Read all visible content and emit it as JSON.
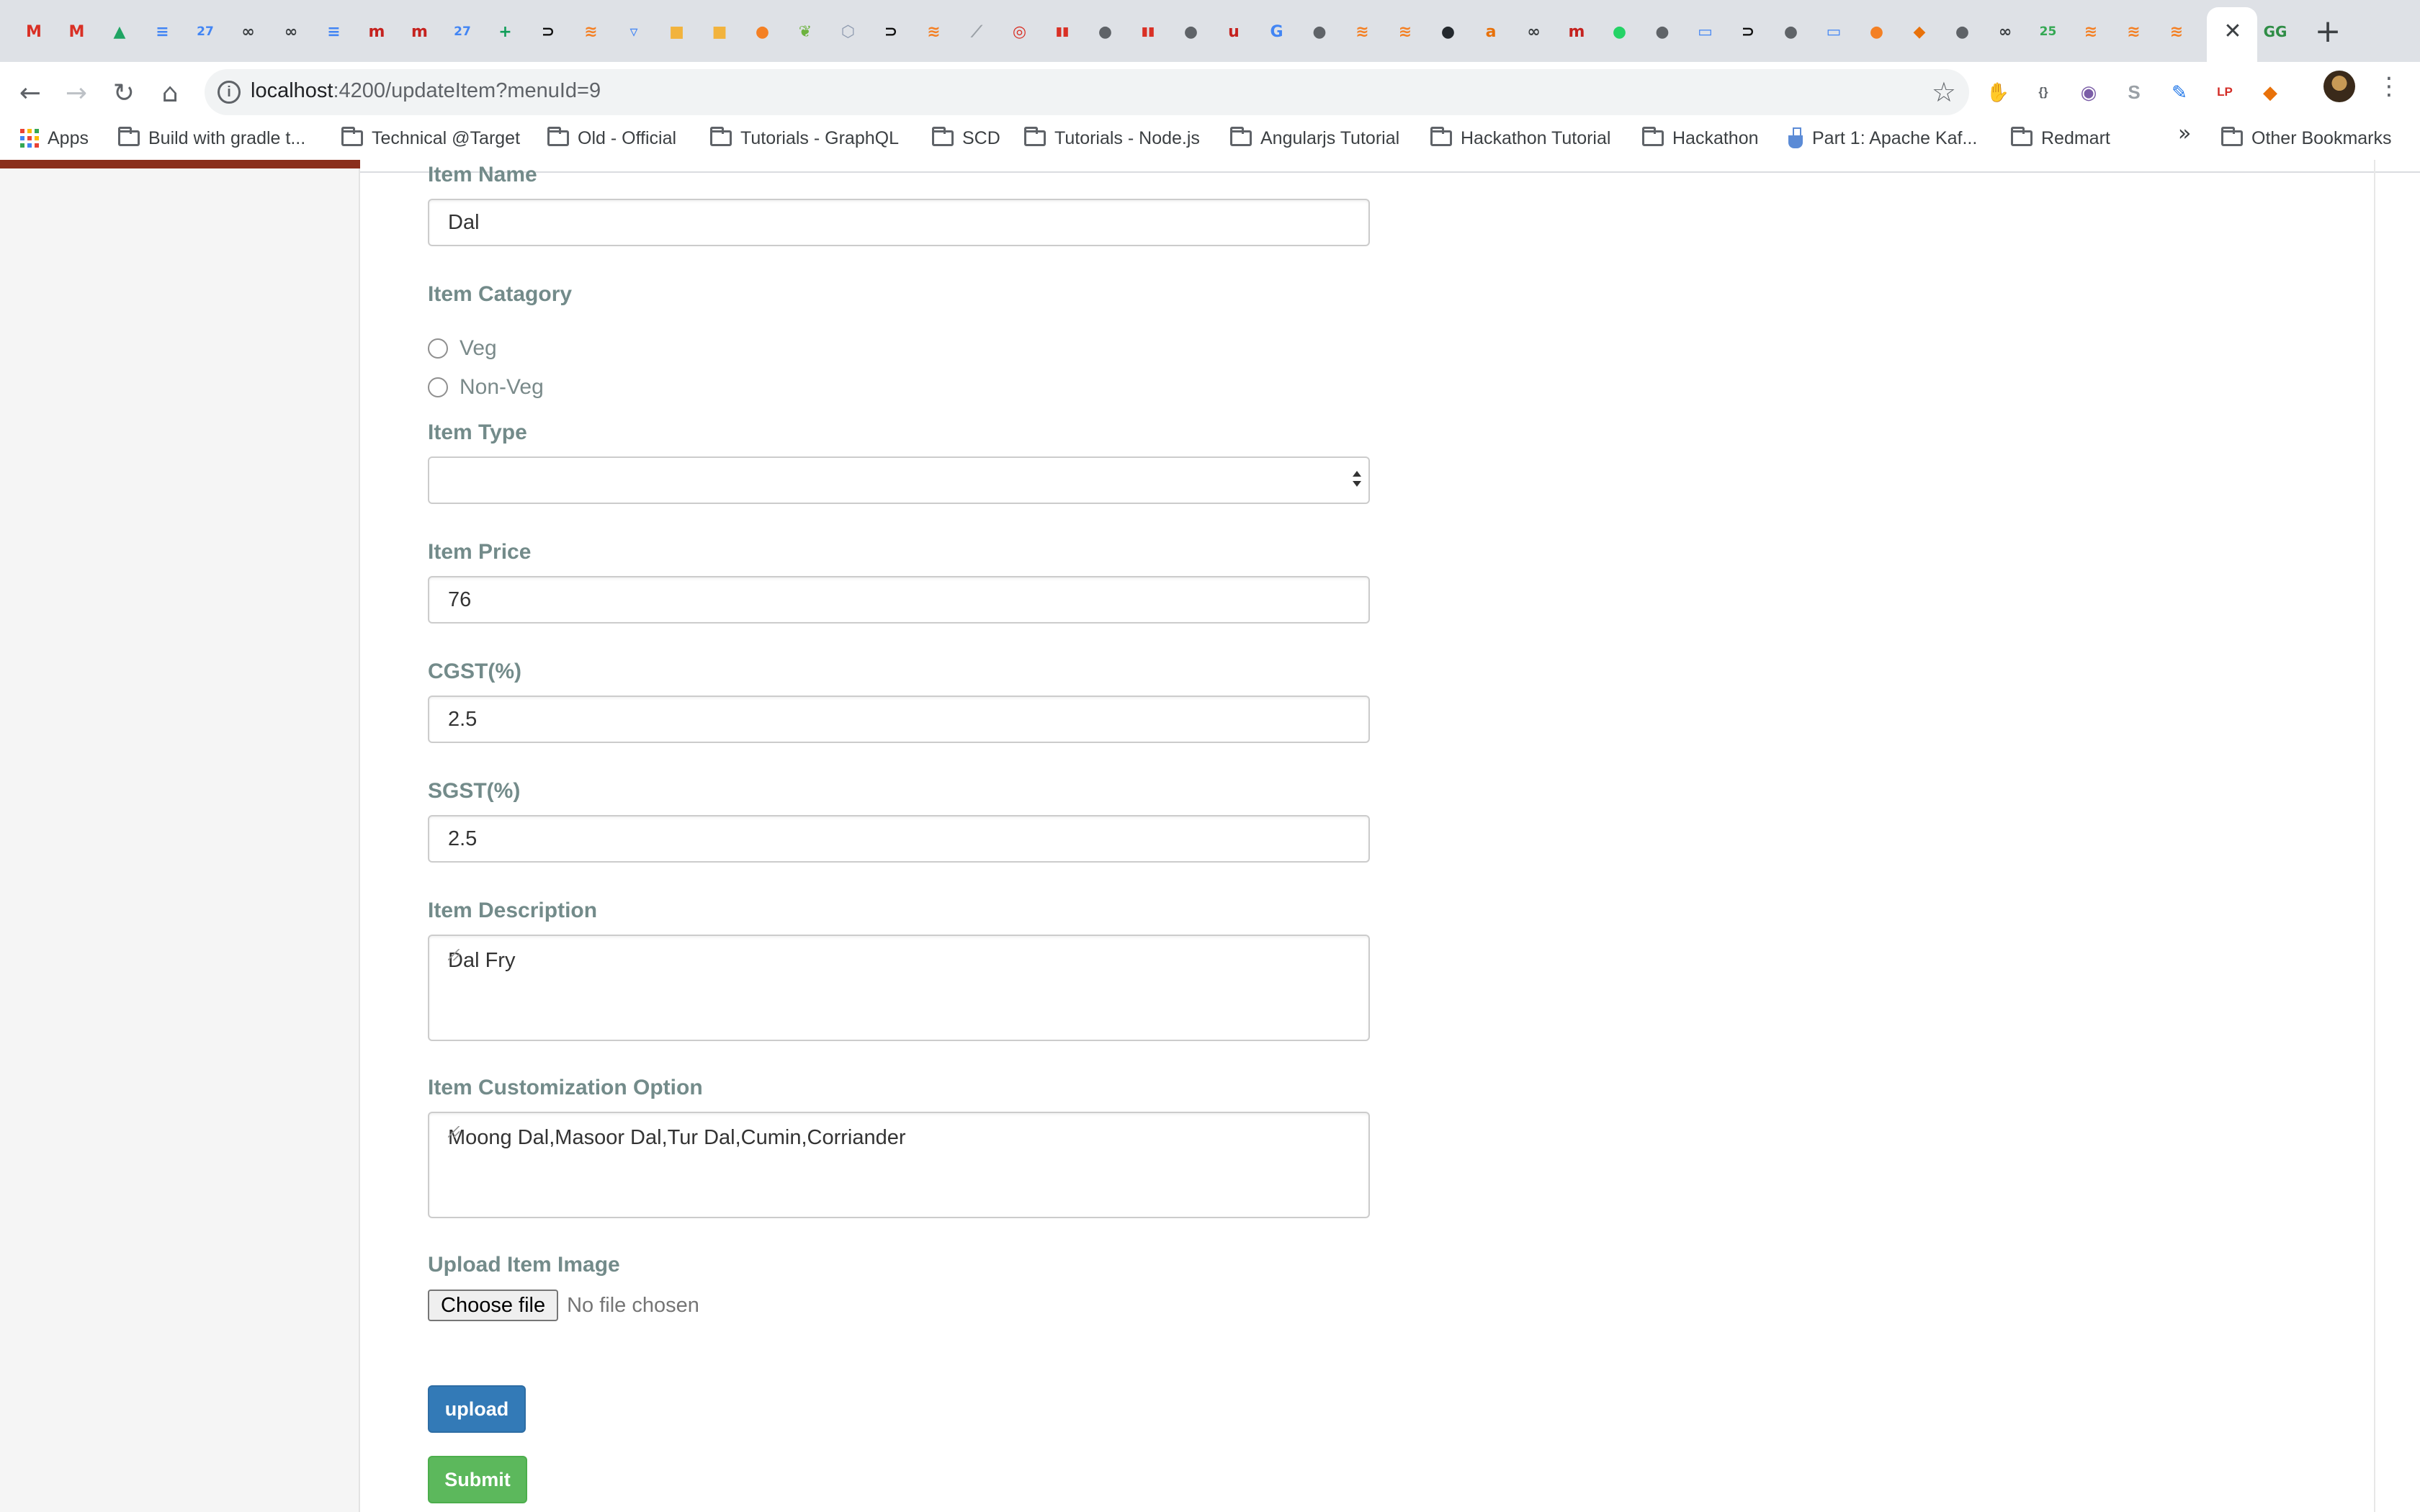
{
  "browser": {
    "url_host": "localhost",
    "url_path": ":4200/updateItem?menuId=9",
    "tab_close_glyph": "✕",
    "new_tab_glyph": "+",
    "tab_favicons": [
      {
        "name": "gmail-icon",
        "glyph": "M",
        "color": "#d93025"
      },
      {
        "name": "gmail-icon",
        "glyph": "M",
        "color": "#d93025"
      },
      {
        "name": "drive-icon",
        "glyph": "▲",
        "color": "#1fa463"
      },
      {
        "name": "docs-icon",
        "glyph": "≡",
        "color": "#4285f4"
      },
      {
        "name": "calendar-icon",
        "glyph": "27",
        "color": "#4285f4"
      },
      {
        "name": "link-icon",
        "glyph": "∞",
        "color": "#3c4043"
      },
      {
        "name": "link-icon",
        "glyph": "∞",
        "color": "#3c4043"
      },
      {
        "name": "docs-icon",
        "glyph": "≡",
        "color": "#4285f4"
      },
      {
        "name": "m-icon",
        "glyph": "m",
        "color": "#c5221f"
      },
      {
        "name": "m-icon",
        "glyph": "m",
        "color": "#c5221f"
      },
      {
        "name": "calendar-icon",
        "glyph": "27",
        "color": "#4285f4"
      },
      {
        "name": "sheets-icon",
        "glyph": "+",
        "color": "#0f9d58"
      },
      {
        "name": "terminal-icon",
        "glyph": "⊃",
        "color": "#111111"
      },
      {
        "name": "stackoverflow-icon",
        "glyph": "≋",
        "color": "#f48024"
      },
      {
        "name": "shield-icon",
        "glyph": "▿",
        "color": "#4285f4"
      },
      {
        "name": "box-icon",
        "glyph": "■",
        "color": "#f2b33d"
      },
      {
        "name": "box-icon",
        "glyph": "■",
        "color": "#f2b33d"
      },
      {
        "name": "pin-icon",
        "glyph": "●",
        "color": "#f48024"
      },
      {
        "name": "leaf-icon",
        "glyph": "❦",
        "color": "#6db33f"
      },
      {
        "name": "hexagon-icon",
        "glyph": "⬡",
        "color": "#8e9aaf"
      },
      {
        "name": "terminal-icon",
        "glyph": "⊃",
        "color": "#111111"
      },
      {
        "name": "stackoverflow-icon",
        "glyph": "≋",
        "color": "#f48024"
      },
      {
        "name": "feather-icon",
        "glyph": "⟋",
        "color": "#9aa0a6"
      },
      {
        "name": "compass-icon",
        "glyph": "◎",
        "color": "#d93025"
      },
      {
        "name": "bars-icon",
        "glyph": "▮▮",
        "color": "#d93025"
      },
      {
        "name": "globe-icon",
        "glyph": "●",
        "color": "#5f6368"
      },
      {
        "name": "bars-icon",
        "glyph": "▮▮",
        "color": "#d93025"
      },
      {
        "name": "globe-icon",
        "glyph": "●",
        "color": "#5f6368"
      },
      {
        "name": "ua-icon",
        "glyph": "u",
        "color": "#c5221f"
      },
      {
        "name": "google-icon",
        "glyph": "G",
        "color": "#4285f4"
      },
      {
        "name": "globe-icon",
        "glyph": "●",
        "color": "#5f6368"
      },
      {
        "name": "stackoverflow-icon",
        "glyph": "≋",
        "color": "#f48024"
      },
      {
        "name": "stackoverflow-icon",
        "glyph": "≋",
        "color": "#f48024"
      },
      {
        "name": "github-icon",
        "glyph": "●",
        "color": "#24292e"
      },
      {
        "name": "ask-icon",
        "glyph": "a",
        "color": "#e8710a"
      },
      {
        "name": "link-icon",
        "glyph": "∞",
        "color": "#3c4043"
      },
      {
        "name": "m-icon",
        "glyph": "m",
        "color": "#c5221f"
      },
      {
        "name": "whatsapp-icon",
        "glyph": "●",
        "color": "#25d366"
      },
      {
        "name": "globe-icon",
        "glyph": "●",
        "color": "#5f6368"
      },
      {
        "name": "chat-icon",
        "glyph": "▭",
        "color": "#4285f4"
      },
      {
        "name": "terminal-icon",
        "glyph": "⊃",
        "color": "#111111"
      },
      {
        "name": "globe-icon",
        "glyph": "●",
        "color": "#5f6368"
      },
      {
        "name": "chat-icon",
        "glyph": "▭",
        "color": "#4285f4"
      },
      {
        "name": "pin-icon",
        "glyph": "●",
        "color": "#f48024"
      },
      {
        "name": "cube-icon",
        "glyph": "◆",
        "color": "#e8710a"
      },
      {
        "name": "globe-icon",
        "glyph": "●",
        "color": "#5f6368"
      },
      {
        "name": "link-icon",
        "glyph": "∞",
        "color": "#3c4043"
      },
      {
        "name": "badge-icon",
        "glyph": "25",
        "color": "#34a853"
      },
      {
        "name": "stackoverflow-icon",
        "glyph": "≋",
        "color": "#f48024"
      },
      {
        "name": "stackoverflow-icon",
        "glyph": "≋",
        "color": "#f48024"
      },
      {
        "name": "stackoverflow-icon",
        "glyph": "≋",
        "color": "#f48024"
      },
      {
        "name": "geeksforgeeks-icon",
        "glyph": "GG",
        "color": "#2f8d46"
      }
    ],
    "extensions": [
      {
        "name": "adblock-icon",
        "glyph": "✋",
        "color": "#d93025"
      },
      {
        "name": "code-icon",
        "glyph": "{}",
        "color": "#5f6368"
      },
      {
        "name": "incognito-icon",
        "glyph": "◉",
        "color": "#7b5ea7"
      },
      {
        "name": "skype-icon",
        "glyph": "S",
        "color": "#9aa0a6"
      },
      {
        "name": "pen-icon",
        "glyph": "✎",
        "color": "#1a73e8"
      },
      {
        "name": "lastpass-icon",
        "glyph": "LP",
        "color": "#d32d27"
      },
      {
        "name": "cookie-icon",
        "glyph": "◆",
        "color": "#e8710a"
      }
    ],
    "bookmarks": [
      {
        "name": "apps-bookmark",
        "icon": "apps",
        "label": "Apps"
      },
      {
        "name": "bookmark-build-with-gradle",
        "icon": "folder",
        "label": "Build with gradle t..."
      },
      {
        "name": "bookmark-technical-target",
        "icon": "folder",
        "label": "Technical @Target"
      },
      {
        "name": "bookmark-old-official",
        "icon": "folder",
        "label": "Old - Official"
      },
      {
        "name": "bookmark-tutorials-graphql",
        "icon": "folder",
        "label": "Tutorials - GraphQL"
      },
      {
        "name": "bookmark-scd",
        "icon": "folder",
        "label": "SCD"
      },
      {
        "name": "bookmark-tutorials-nodejs",
        "icon": "folder",
        "label": "Tutorials - Node.js"
      },
      {
        "name": "bookmark-angularjs-tutorial",
        "icon": "folder",
        "label": "Angularjs Tutorial"
      },
      {
        "name": "bookmark-hackathon-tutorial",
        "icon": "folder",
        "label": "Hackathon Tutorial"
      },
      {
        "name": "bookmark-hackathon",
        "icon": "folder",
        "label": "Hackathon"
      },
      {
        "name": "bookmark-apache-kafka",
        "icon": "flask",
        "label": "Part 1: Apache Kaf..."
      },
      {
        "name": "bookmark-redmart",
        "icon": "folder",
        "label": "Redmart"
      }
    ],
    "bookmarks_overflow": "»",
    "other_bookmarks": "Other Bookmarks"
  },
  "form": {
    "item_name": {
      "label": "Item Name",
      "value": "Dal"
    },
    "item_category": {
      "label": "Item Catagory",
      "options": [
        "Veg",
        "Non-Veg"
      ]
    },
    "item_type": {
      "label": "Item Type",
      "selected": ""
    },
    "item_price": {
      "label": "Item Price",
      "value": "76"
    },
    "cgst": {
      "label": "CGST(%)",
      "value": "2.5"
    },
    "sgst": {
      "label": "SGST(%)",
      "value": "2.5"
    },
    "item_description": {
      "label": "Item Description",
      "value": "Dal Fry"
    },
    "item_customization": {
      "label": "Item Customization Option",
      "value": "Moong Dal,Masoor Dal,Tur Dal,Cumin,Corriander"
    },
    "upload_image": {
      "label": "Upload Item Image",
      "button": "Choose file",
      "status": "No file chosen"
    },
    "upload_button": "upload",
    "submit_button": "Submit"
  },
  "colors": {
    "label": "#738b8a",
    "upload_btn": "#337ab7",
    "submit_btn": "#5cb85c",
    "sidebar_accent": "#8a2f1c"
  }
}
